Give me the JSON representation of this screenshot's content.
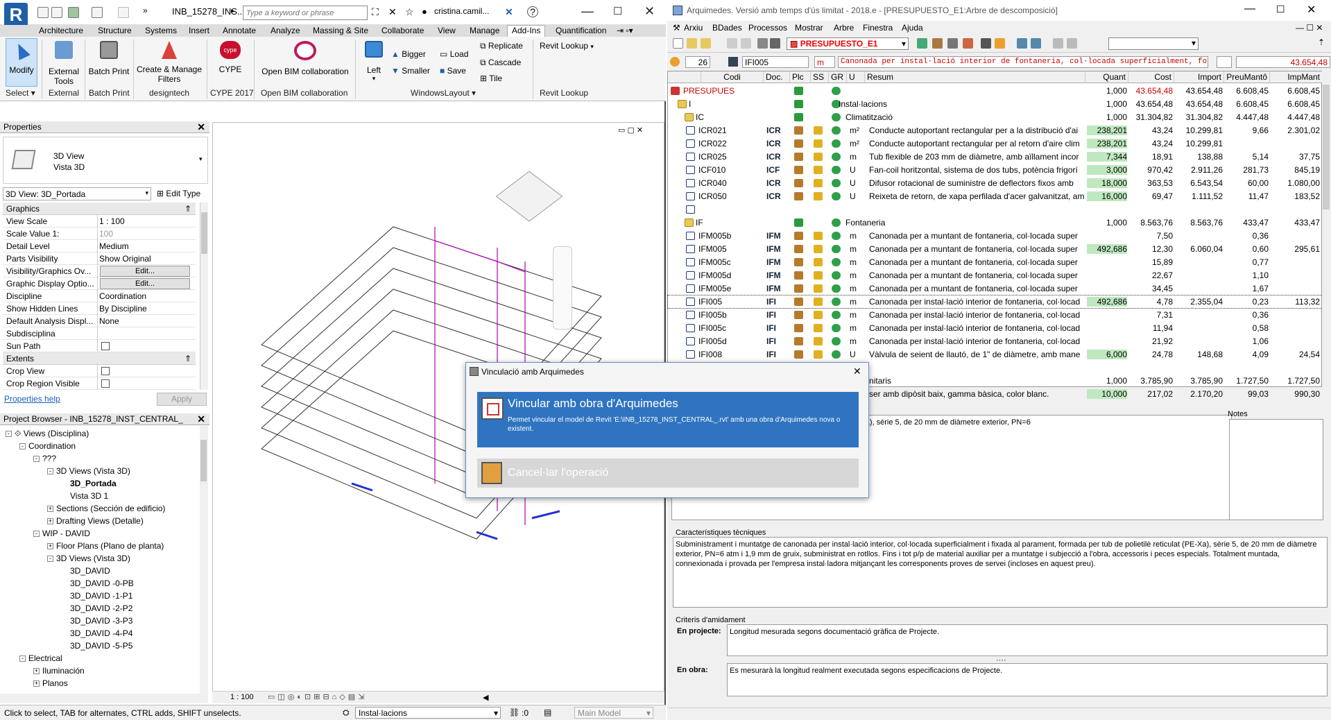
{
  "revit": {
    "file_title": "INB_15278_INS...",
    "search_placeholder": "Type a keyword or phrase",
    "user": "cristina.camil...",
    "tabs": [
      "Architecture",
      "Structure",
      "Systems",
      "Insert",
      "Annotate",
      "Analyze",
      "Massing & Site",
      "Collaborate",
      "View",
      "Manage",
      "Add-Ins",
      "Quantification"
    ],
    "active_tab": "Add-Ins",
    "ribbon": {
      "modify": "Modify",
      "external_tools": [
        "External",
        "Tools"
      ],
      "batch_print": "Batch Print",
      "create_manage": [
        "Create & Manage",
        "Filters"
      ],
      "cype": "CYPE",
      "open_bim": "Open BIM collaboration",
      "left": "Left",
      "bigger": "Bigger",
      "smaller": "Smaller",
      "load": "Load",
      "save": "Save",
      "replicate": "Replicate",
      "cascade": "Cascade",
      "tile": "Tile",
      "revit_lookup": "Revit Lookup",
      "panels": [
        "Select",
        "External",
        "Batch Print",
        "designtech",
        "CYPE 2017",
        "Open BIM collaboration",
        "WindowsLayout",
        "Revit Lookup"
      ]
    },
    "properties": {
      "title": "Properties",
      "type_line1": "3D View",
      "type_line2": "Vista 3D",
      "instance": "3D View: 3D_Portada",
      "edit_type": "Edit Type",
      "section_graphics": "Graphics",
      "rows": [
        {
          "k": "View Scale",
          "v": "1 : 100"
        },
        {
          "k": "Scale Value    1:",
          "v": "100"
        },
        {
          "k": "Detail Level",
          "v": "Medium"
        },
        {
          "k": "Parts Visibility",
          "v": "Show Original"
        },
        {
          "k": "Visibility/Graphics Ov...",
          "v": "Edit..."
        },
        {
          "k": "Graphic Display Optio...",
          "v": "Edit..."
        },
        {
          "k": "Discipline",
          "v": "Coordination"
        },
        {
          "k": "Show Hidden Lines",
          "v": "By Discipline"
        },
        {
          "k": "Default Analysis Displ...",
          "v": "None"
        },
        {
          "k": "Subdisciplina",
          "v": ""
        },
        {
          "k": "Sun Path",
          "v": ""
        }
      ],
      "section_extents": "Extents",
      "extents_rows": [
        {
          "k": "Crop View",
          "v": ""
        },
        {
          "k": "Crop Region Visible",
          "v": ""
        }
      ],
      "help": "Properties help",
      "apply": "Apply"
    },
    "browser": {
      "title": "Project Browser - INB_15278_INST_CENTRAL_",
      "nodes": [
        {
          "t": "Views (Disciplina)",
          "l": 0,
          "e": "-"
        },
        {
          "t": "Coordination",
          "l": 1,
          "e": "-"
        },
        {
          "t": "???",
          "l": 2,
          "e": "-"
        },
        {
          "t": "3D Views (Vista 3D)",
          "l": 3,
          "e": "-"
        },
        {
          "t": "3D_Portada",
          "l": 4,
          "e": "",
          "b": true
        },
        {
          "t": "Vista 3D 1",
          "l": 4,
          "e": ""
        },
        {
          "t": "Sections (Sección de edificio)",
          "l": 3,
          "e": "+"
        },
        {
          "t": "Drafting Views (Detalle)",
          "l": 3,
          "e": "+"
        },
        {
          "t": "WIP - DAVID",
          "l": 2,
          "e": "-"
        },
        {
          "t": "Floor Plans (Plano de planta)",
          "l": 3,
          "e": "+"
        },
        {
          "t": "3D Views (Vista 3D)",
          "l": 3,
          "e": "-"
        },
        {
          "t": "3D_DAVID",
          "l": 4,
          "e": ""
        },
        {
          "t": "3D_DAVID -0-PB",
          "l": 4,
          "e": ""
        },
        {
          "t": "3D_DAVID -1-P1",
          "l": 4,
          "e": ""
        },
        {
          "t": "3D_DAVID -2-P2",
          "l": 4,
          "e": ""
        },
        {
          "t": "3D_DAVID -3-P3",
          "l": 4,
          "e": ""
        },
        {
          "t": "3D_DAVID -4-P4",
          "l": 4,
          "e": ""
        },
        {
          "t": "3D_DAVID -5-P5",
          "l": 4,
          "e": ""
        },
        {
          "t": "Electrical",
          "l": 1,
          "e": "-"
        },
        {
          "t": "Iluminación",
          "l": 2,
          "e": "+"
        },
        {
          "t": "Planos",
          "l": 2,
          "e": "+"
        }
      ]
    },
    "view_scale": "1 : 100",
    "status": "Click to select, TAB for alternates, CTRL adds, SHIFT unselects.",
    "workset": "Instal·lacions",
    "zero": ":0",
    "model": "Main Model"
  },
  "arq": {
    "title": "Arquimedes. Versió amb temps d'ús limitat - 2018.e - [PRESUPUESTO_E1:Arbre de descomposició]",
    "menu": [
      "Arxiu",
      "BDades",
      "Processos",
      "Mostrar",
      "Arbre",
      "Finestra",
      "Ajuda"
    ],
    "budget": "PRESUPUESTO_E1",
    "code_bar": {
      "num": "26",
      "code": "IFI005",
      "unit": "m",
      "desc": "Canonada per instal·lació interior de fontaneria, col·locada superficialment, fo",
      "price": "43.654,48"
    },
    "headers": [
      "Codi",
      "Doc.",
      "Plc",
      "SS",
      "GR",
      "U",
      "Resum",
      "Quant",
      "Cost",
      "Import",
      "PreuMantô",
      "ImpMant"
    ],
    "rows": [
      {
        "code": "PRESUPUES",
        "doc": "",
        "u": "",
        "res": "",
        "q": "1,000",
        "cost": "43.654,48",
        "imp": "43.654,48",
        "pm": "6.608,45",
        "im": "6.608,45",
        "lvl": 0,
        "red": true
      },
      {
        "code": "I",
        "doc": "",
        "u": "",
        "res": "Instal·lacions",
        "q": "1,000",
        "cost": "43.654,48",
        "imp": "43.654,48",
        "pm": "6.608,45",
        "im": "6.608,45",
        "lvl": 1
      },
      {
        "code": "IC",
        "doc": "",
        "u": "",
        "res": "Climatització",
        "q": "1,000",
        "cost": "31.304,82",
        "imp": "31.304,82",
        "pm": "4.447,48",
        "im": "4.447,48",
        "lvl": 2
      },
      {
        "code": "ICR021",
        "doc": "ICR",
        "u": "m²",
        "res": "Conducte autoportant rectangular per a la distribució d'ai",
        "q": "238,201",
        "cost": "43,24",
        "imp": "10.299,81",
        "pm": "9,66",
        "im": "2.301,02",
        "lvl": 3,
        "hq": true
      },
      {
        "code": "ICR022",
        "doc": "ICR",
        "u": "m²",
        "res": "Conducte autoportant rectangular per al retorn d'aire clim",
        "q": "238,201",
        "cost": "43,24",
        "imp": "10.299,81",
        "pm": "",
        "im": "",
        "lvl": 3,
        "hq": true
      },
      {
        "code": "ICR025",
        "doc": "ICR",
        "u": "m",
        "res": "Tub flexible de 203 mm de diàmetre, amb aïllament incor",
        "q": "7,344",
        "cost": "18,91",
        "imp": "138,88",
        "pm": "5,14",
        "im": "37,75",
        "lvl": 3,
        "hq": true
      },
      {
        "code": "ICF010",
        "doc": "ICF",
        "u": "U",
        "res": "Fan-coil horitzontal, sistema de dos tubs, potència frigorí",
        "q": "3,000",
        "cost": "970,42",
        "imp": "2.911,26",
        "pm": "281,73",
        "im": "845,19",
        "lvl": 3,
        "hq": true
      },
      {
        "code": "ICR040",
        "doc": "ICR",
        "u": "U",
        "res": "Difusor rotacional de suministre de deflectors fixos amb",
        "q": "18,000",
        "cost": "363,53",
        "imp": "6.543,54",
        "pm": "60,00",
        "im": "1.080,00",
        "lvl": 3,
        "hq": true
      },
      {
        "code": "ICR050",
        "doc": "ICR",
        "u": "U",
        "res": "Reixeta de retorn, de xapa perfilada d'acer galvanitzat, amb",
        "q": "16,000",
        "cost": "69,47",
        "imp": "1.111,52",
        "pm": "11,47",
        "im": "183,52",
        "lvl": 3,
        "hq": true
      },
      {
        "code": "",
        "doc": "",
        "u": "",
        "res": "",
        "q": "",
        "cost": "",
        "imp": "",
        "pm": "",
        "im": "",
        "lvl": 3,
        "empty": true
      },
      {
        "code": "IF",
        "doc": "",
        "u": "",
        "res": "Fontaneria",
        "q": "1,000",
        "cost": "8.563,76",
        "imp": "8.563,76",
        "pm": "433,47",
        "im": "433,47",
        "lvl": 2
      },
      {
        "code": "IFM005b",
        "doc": "IFM",
        "u": "m",
        "res": "Canonada per a muntant de fontaneria, col·locada super",
        "q": "",
        "cost": "7,50",
        "imp": "",
        "pm": "0,36",
        "im": "",
        "lvl": 3
      },
      {
        "code": "IFM005",
        "doc": "IFM",
        "u": "m",
        "res": "Canonada per a muntant de fontaneria, col·locada super",
        "q": "492,686",
        "cost": "12,30",
        "imp": "6.060,04",
        "pm": "0,60",
        "im": "295,61",
        "lvl": 3,
        "hq": true
      },
      {
        "code": "IFM005c",
        "doc": "IFM",
        "u": "m",
        "res": "Canonada per a muntant de fontaneria, col·locada super",
        "q": "",
        "cost": "15,89",
        "imp": "",
        "pm": "0,77",
        "im": "",
        "lvl": 3
      },
      {
        "code": "IFM005d",
        "doc": "IFM",
        "u": "m",
        "res": "Canonada per a muntant de fontaneria, col·locada super",
        "q": "",
        "cost": "22,67",
        "imp": "",
        "pm": "1,10",
        "im": "",
        "lvl": 3
      },
      {
        "code": "IFM005e",
        "doc": "IFM",
        "u": "m",
        "res": "Canonada per a muntant de fontaneria, col·locada super",
        "q": "",
        "cost": "34,45",
        "imp": "",
        "pm": "1,67",
        "im": "",
        "lvl": 3
      },
      {
        "code": "IFI005",
        "doc": "IFI",
        "u": "m",
        "res": "Canonada per instal·lació interior de fontaneria, col·locad",
        "q": "492,686",
        "cost": "4,78",
        "imp": "2.355,04",
        "pm": "0,23",
        "im": "113,32",
        "lvl": 3,
        "hq": true,
        "sel": true
      },
      {
        "code": "IFI005b",
        "doc": "IFI",
        "u": "m",
        "res": "Canonada per instal·lació interior de fontaneria, col·locad",
        "q": "",
        "cost": "7,31",
        "imp": "",
        "pm": "0,36",
        "im": "",
        "lvl": 3
      },
      {
        "code": "IFI005c",
        "doc": "IFI",
        "u": "m",
        "res": "Canonada per instal·lació interior de fontaneria, col·locad",
        "q": "",
        "cost": "11,94",
        "imp": "",
        "pm": "0,58",
        "im": "",
        "lvl": 3
      },
      {
        "code": "IFI005d",
        "doc": "IFI",
        "u": "m",
        "res": "Canonada per instal·lació interior de fontaneria, col·locad",
        "q": "",
        "cost": "21,92",
        "imp": "",
        "pm": "1,06",
        "im": "",
        "lvl": 3
      },
      {
        "code": "IFI008",
        "doc": "IFI",
        "u": "U",
        "res": "Vàlvula de seient de llautó, de 1\" de diàmetre, amb mane",
        "q": "6,000",
        "cost": "24,78",
        "imp": "148,68",
        "pm": "4,09",
        "im": "24,54",
        "lvl": 3,
        "hq": true
      },
      {
        "code": "",
        "doc": "",
        "u": "",
        "res": "",
        "q": "",
        "cost": "",
        "imp": "",
        "pm": "",
        "im": "",
        "lvl": 3,
        "empty": true
      },
      {
        "code": "",
        "doc": "",
        "u": "",
        "res": "ells sanitaris",
        "q": "1,000",
        "cost": "3.785,90",
        "imp": "3.785,90",
        "pm": "1.727,50",
        "im": "1.727,50",
        "lvl": 2
      },
      {
        "code": "",
        "doc": "",
        "u": "",
        "res": "ser amb dipòsit baix, gamma bàsica, color blanc.",
        "q": "10,000",
        "cost": "217,02",
        "imp": "2.170,20",
        "pm": "99,03",
        "im": "990,30",
        "lvl": 3,
        "hq": true
      }
    ],
    "notes_label": "Notes",
    "desc_text": "perficialment, formada per tub de polietilè reticulat (PE-Xa), sèrie 5, de 20 mm de diàmetre exterior, PN=6",
    "tech_label": "Característiques tècniques",
    "tech_text": "Subministrament i muntatge de canonada per instal·lació interior, col·locada superficialment i fixada al parament, formada per tub de polietilè reticulat (PE-Xa), sèrie 5, de 20 mm de diàmetre exterior, PN=6 atm i 1,9 mm de gruix, subministrat en rotllos. Fins i tot p/p de material auxiliar per a muntatge i subjecció a l'obra, accessoris i peces especials. Totalment muntada, connexionada i provada per l'empresa instal·ladora mitjançant les corresponents proves de servei (incloses en aquest preu).",
    "crit_label": "Criteris d'amidament",
    "proj_label": "En projecte:",
    "proj_text": "Longitud mesurada segons documentació gràfica de Projecte.",
    "obra_label": "En obra:",
    "obra_text": "Es mesurarà la longitud realment executada segons especificacions de Projecte."
  },
  "dialog": {
    "title": "Vinculació amb Arquimedes",
    "opt1_title": "Vincular amb obra d'Arquimedes",
    "opt1_desc": "Permet vincular el model de Revit 'E:\\INB_15278_INST_CENTRAL_.rvt' amb una obra d'Arquimedes nova o existent.",
    "opt2_title": "Cancel·lar l'operació"
  }
}
